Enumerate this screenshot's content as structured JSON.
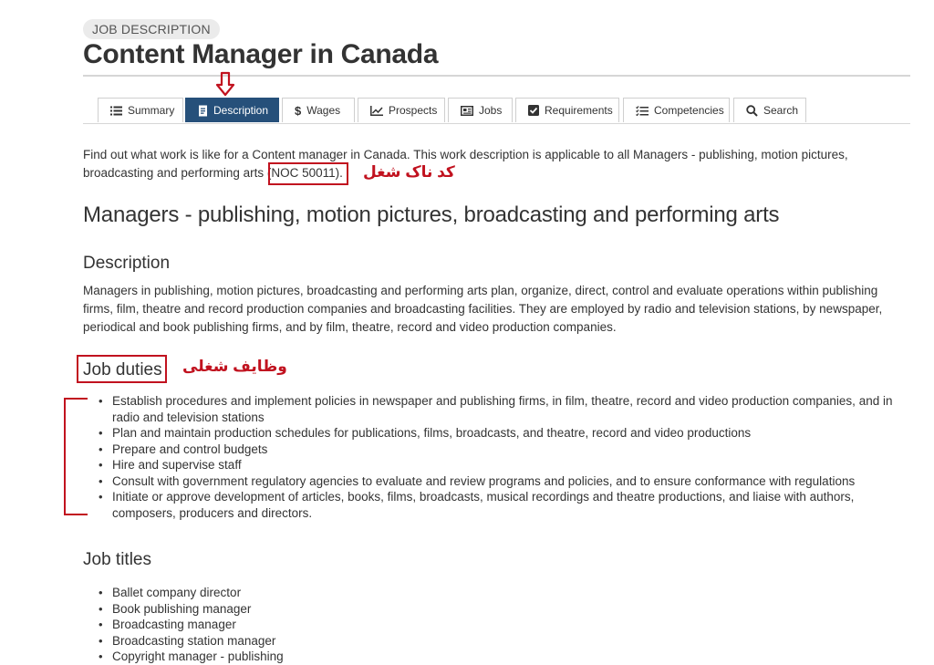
{
  "header": {
    "badge": "JOB DESCRIPTION",
    "title": "Content Manager in Canada"
  },
  "tabs": [
    {
      "label": "Summary",
      "icon": "list-icon",
      "active": false
    },
    {
      "label": "Description",
      "icon": "document-icon",
      "active": true
    },
    {
      "label": "Wages",
      "icon": "dollar-icon",
      "active": false
    },
    {
      "label": "Prospects",
      "icon": "trend-chart-icon",
      "active": false
    },
    {
      "label": "Jobs",
      "icon": "newspaper-icon",
      "active": false
    },
    {
      "label": "Requirements",
      "icon": "checkbox-icon",
      "active": false
    },
    {
      "label": "Competencies",
      "icon": "checklist-icon",
      "active": false
    },
    {
      "label": "Search",
      "icon": "search-icon",
      "active": false
    }
  ],
  "intro": {
    "text_before": "Find out what work is like for a Content manager in Canada. This work description is applicable to all Managers - publishing, motion pictures, broadcasting and performing arts ",
    "noc": "(NOC 50011)."
  },
  "annotations": {
    "noc_note": "کد ناک شغل",
    "duties_note": "وظایف شغلی",
    "color": "#c1121f"
  },
  "occupation_title": "Managers - publishing, motion pictures, broadcasting and performing arts",
  "description": {
    "heading": "Description",
    "text": "Managers in publishing, motion pictures, broadcasting and performing arts plan, organize, direct, control and evaluate operations within publishing firms, film, theatre and record production companies and broadcasting facilities. They are employed by radio and television stations, by newspaper, periodical and book publishing firms, and by film, theatre, record and video production companies."
  },
  "duties": {
    "heading": "Job duties",
    "items": [
      "Establish procedures and implement policies in newspaper and publishing firms, in film, theatre, record and video production companies, and in radio and television stations",
      "Plan and maintain production schedules for publications, films, broadcasts, and theatre, record and video productions",
      "Prepare and control budgets",
      "Hire and supervise staff",
      "Consult with government regulatory agencies to evaluate and review programs and policies, and to ensure conformance with regulations",
      "Initiate or approve development of articles, books, films, broadcasts, musical recordings and theatre productions, and liaise with authors, composers, producers and directors."
    ]
  },
  "job_titles": {
    "heading": "Job titles",
    "items": [
      "Ballet company director",
      "Book publishing manager",
      "Broadcasting manager",
      "Broadcasting station manager",
      "Copyright manager - publishing"
    ]
  },
  "colors": {
    "active_tab": "#26507a",
    "text": "#333333",
    "highlight": "#c1121f"
  }
}
